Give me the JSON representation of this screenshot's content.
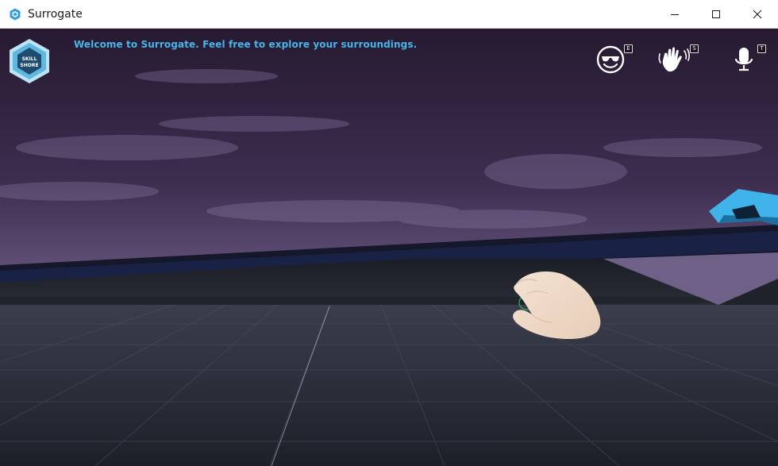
{
  "window": {
    "title": "Surrogate",
    "controls": [
      "minimize-icon",
      "maximize-icon",
      "close-icon"
    ]
  },
  "hud": {
    "welcome_message": "Welcome to Surrogate. Feel free to explore your surroundings.",
    "logo_text_line1": "SKILL",
    "logo_text_line2": "SHORE",
    "buttons": [
      {
        "icon": "emote-sunglasses-icon",
        "key": "E"
      },
      {
        "icon": "wave-hand-icon",
        "key": "S"
      },
      {
        "icon": "microphone-icon",
        "key": "T"
      }
    ]
  },
  "colors": {
    "accent": "#48b4e8",
    "sky_top": "#2a1d36",
    "sky_bottom": "#6e6183",
    "floor": "#2f3240"
  }
}
